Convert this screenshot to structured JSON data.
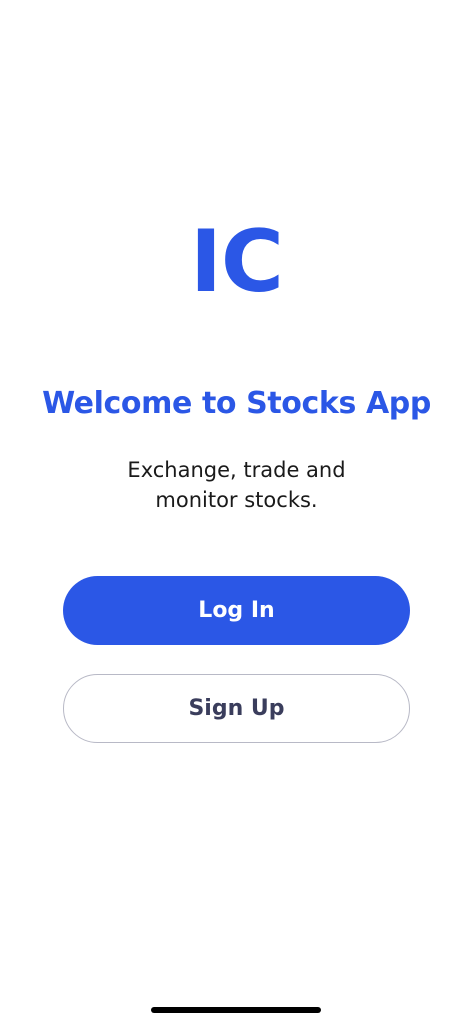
{
  "brand": {
    "logo_text": "IC",
    "accent_color": "#2b57e6"
  },
  "welcome": {
    "title": "Welcome to Stocks App",
    "subtitle_line1": "Exchange, trade and",
    "subtitle_line2": "monitor stocks."
  },
  "actions": {
    "login_label": "Log In",
    "signup_label": "Sign Up"
  }
}
